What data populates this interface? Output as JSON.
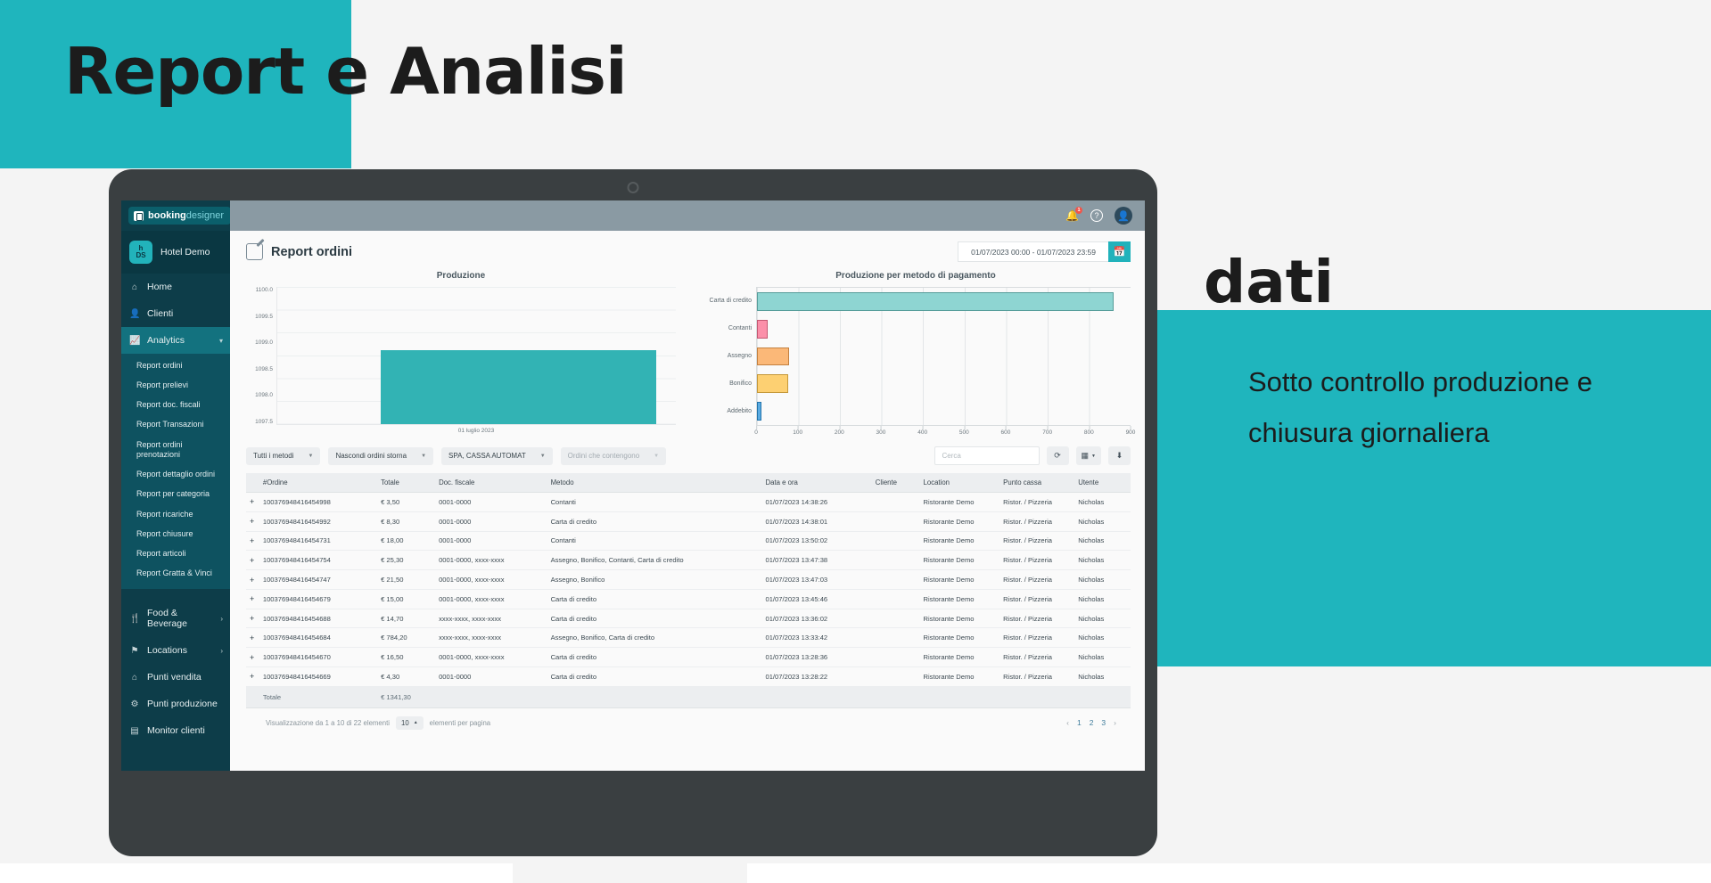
{
  "promo": {
    "title": "Report e Analisi",
    "subtitle": "dati",
    "body": "Sotto controllo produzione e chiusura giornaliera",
    "teal": "#1fb5bd"
  },
  "sidebar": {
    "brand_bold": "booking",
    "brand_light": "designer",
    "menu_icon": "hamburger-icon",
    "hotel": {
      "logo_line1": "h",
      "logo_line2": "DS",
      "name": "Hotel Demo"
    },
    "top_items": [
      {
        "label": "Home",
        "icon": "home-icon"
      },
      {
        "label": "Clienti",
        "icon": "users-icon"
      }
    ],
    "analytics": {
      "label": "Analytics",
      "icon": "chart-icon",
      "caret": "chevron-down-icon",
      "items": [
        "Report ordini",
        "Report prelievi",
        "Report doc. fiscali",
        "Report Transazioni",
        "Report ordini prenotazioni",
        "Report dettaglio ordini",
        "Report per categoria",
        "Report ricariche",
        "Report chiusure",
        "Report articoli",
        "Report Gratta & Vinci"
      ]
    },
    "bottom_items": [
      {
        "label": "Food & Beverage",
        "icon": "cutlery-icon",
        "caret": "chevron-right-icon"
      },
      {
        "label": "Locations",
        "icon": "pin-icon",
        "caret": "chevron-right-icon"
      },
      {
        "label": "Punti vendita",
        "icon": "store-icon",
        "caret": ""
      },
      {
        "label": "Punti produzione",
        "icon": "factory-icon",
        "caret": ""
      },
      {
        "label": "Monitor clienti",
        "icon": "monitor-icon",
        "caret": ""
      }
    ]
  },
  "topbar": {
    "bell_icon": "bell-icon",
    "bell_badge": "1",
    "help_icon": "help-icon",
    "help_glyph": "?",
    "avatar_icon": "avatar-icon"
  },
  "page": {
    "icon": "edit-document-icon",
    "title": "Report ordini",
    "daterange_value": "01/07/2023 00:00 - 01/07/2023 23:59",
    "daterange_button_icon": "calendar-icon"
  },
  "chart_data": [
    {
      "type": "bar",
      "orientation": "vertical",
      "title": "Produzione",
      "categories": [
        "01 luglio 2023"
      ],
      "values": [
        1098.85
      ],
      "xlabel": "01 luglio 2023",
      "ylabel": "",
      "ylim": [
        1097.5,
        1100.0
      ],
      "yticks": [
        "1100.0",
        "1099.5",
        "1099.0",
        "1098.5",
        "1098.0",
        "1097.5"
      ],
      "grid": true,
      "color": "#32b3b4",
      "legend": "none"
    },
    {
      "type": "bar",
      "orientation": "horizontal",
      "title": "Produzione per metodo di pagamento",
      "categories": [
        "Carta di credito",
        "Contanti",
        "Assegno",
        "Bonifico",
        "Addebito"
      ],
      "values": [
        860,
        25,
        78,
        75,
        10
      ],
      "xlabel": "",
      "ylabel": "",
      "xlim": [
        0,
        900
      ],
      "xticks": [
        0,
        100,
        200,
        300,
        400,
        500,
        600,
        700,
        800,
        900
      ],
      "grid": true,
      "colors": [
        "#8ed5d2",
        "#fb8fa9",
        "#fbb878",
        "#fdd072",
        "#5aabe2"
      ],
      "legend": "none"
    }
  ],
  "toolbar": {
    "filters": [
      {
        "label": "Tutti i metodi",
        "muted": false
      },
      {
        "label": "Nascondi ordini storna",
        "muted": false
      },
      {
        "label": "SPA, CASSA AUTOMAT",
        "muted": false
      },
      {
        "label": "Ordini che contengono",
        "muted": true
      }
    ],
    "search_placeholder": "Cerca",
    "search_value": "",
    "refresh_icon": "refresh-icon",
    "columns_icon": "columns-icon",
    "download_icon": "download-icon"
  },
  "table": {
    "columns": [
      "#Ordine",
      "Totale",
      "Doc. fiscale",
      "Metodo",
      "Data e ora",
      "Cliente",
      "Location",
      "Punto cassa",
      "Utente"
    ],
    "expand_icon": "plus-icon",
    "rows": [
      [
        "100376948416454998",
        "€ 3,50",
        "0001-0000",
        "Contanti",
        "01/07/2023 14:38:26",
        "",
        "Ristorante Demo",
        "Ristor. / Pizzeria",
        "Nicholas"
      ],
      [
        "100376948416454992",
        "€ 8,30",
        "0001-0000",
        "Carta di credito",
        "01/07/2023 14:38:01",
        "",
        "Ristorante Demo",
        "Ristor. / Pizzeria",
        "Nicholas"
      ],
      [
        "100376948416454731",
        "€ 18,00",
        "0001-0000",
        "Contanti",
        "01/07/2023 13:50:02",
        "",
        "Ristorante Demo",
        "Ristor. / Pizzeria",
        "Nicholas"
      ],
      [
        "100376948416454754",
        "€ 25,30",
        "0001-0000, xxxx-xxxx",
        "Assegno, Bonifico, Contanti, Carta di credito",
        "01/07/2023 13:47:38",
        "",
        "Ristorante Demo",
        "Ristor. / Pizzeria",
        "Nicholas"
      ],
      [
        "100376948416454747",
        "€ 21,50",
        "0001-0000, xxxx-xxxx",
        "Assegno, Bonifico",
        "01/07/2023 13:47:03",
        "",
        "Ristorante Demo",
        "Ristor. / Pizzeria",
        "Nicholas"
      ],
      [
        "100376948416454679",
        "€ 15,00",
        "0001-0000, xxxx-xxxx",
        "Carta di credito",
        "01/07/2023 13:45:46",
        "",
        "Ristorante Demo",
        "Ristor. / Pizzeria",
        "Nicholas"
      ],
      [
        "100376948416454688",
        "€ 14,70",
        "xxxx-xxxx, xxxx-xxxx",
        "Carta di credito",
        "01/07/2023 13:36:02",
        "",
        "Ristorante Demo",
        "Ristor. / Pizzeria",
        "Nicholas"
      ],
      [
        "100376948416454684",
        "€ 784,20",
        "xxxx-xxxx, xxxx-xxxx",
        "Assegno, Bonifico, Carta di credito",
        "01/07/2023 13:33:42",
        "",
        "Ristorante Demo",
        "Ristor. / Pizzeria",
        "Nicholas"
      ],
      [
        "100376948416454670",
        "€ 16,50",
        "0001-0000, xxxx-xxxx",
        "Carta di credito",
        "01/07/2023 13:28:36",
        "",
        "Ristorante Demo",
        "Ristor. / Pizzeria",
        "Nicholas"
      ],
      [
        "100376948416454669",
        "€ 4,30",
        "0001-0000",
        "Carta di credito",
        "01/07/2023 13:28:22",
        "",
        "Ristorante Demo",
        "Ristor. / Pizzeria",
        "Nicholas"
      ]
    ],
    "total_label": "Totale",
    "total_value": "€ 1341,30"
  },
  "footer": {
    "summary": "Visualizzazione da 1 a 10 di 22 elementi",
    "per_page_value": "10",
    "per_page_caret": "caret-up-icon",
    "per_page_label": "elementi per pagina",
    "prev_icon": "‹",
    "next_icon": "›",
    "pages": [
      "1",
      "2",
      "3"
    ]
  }
}
